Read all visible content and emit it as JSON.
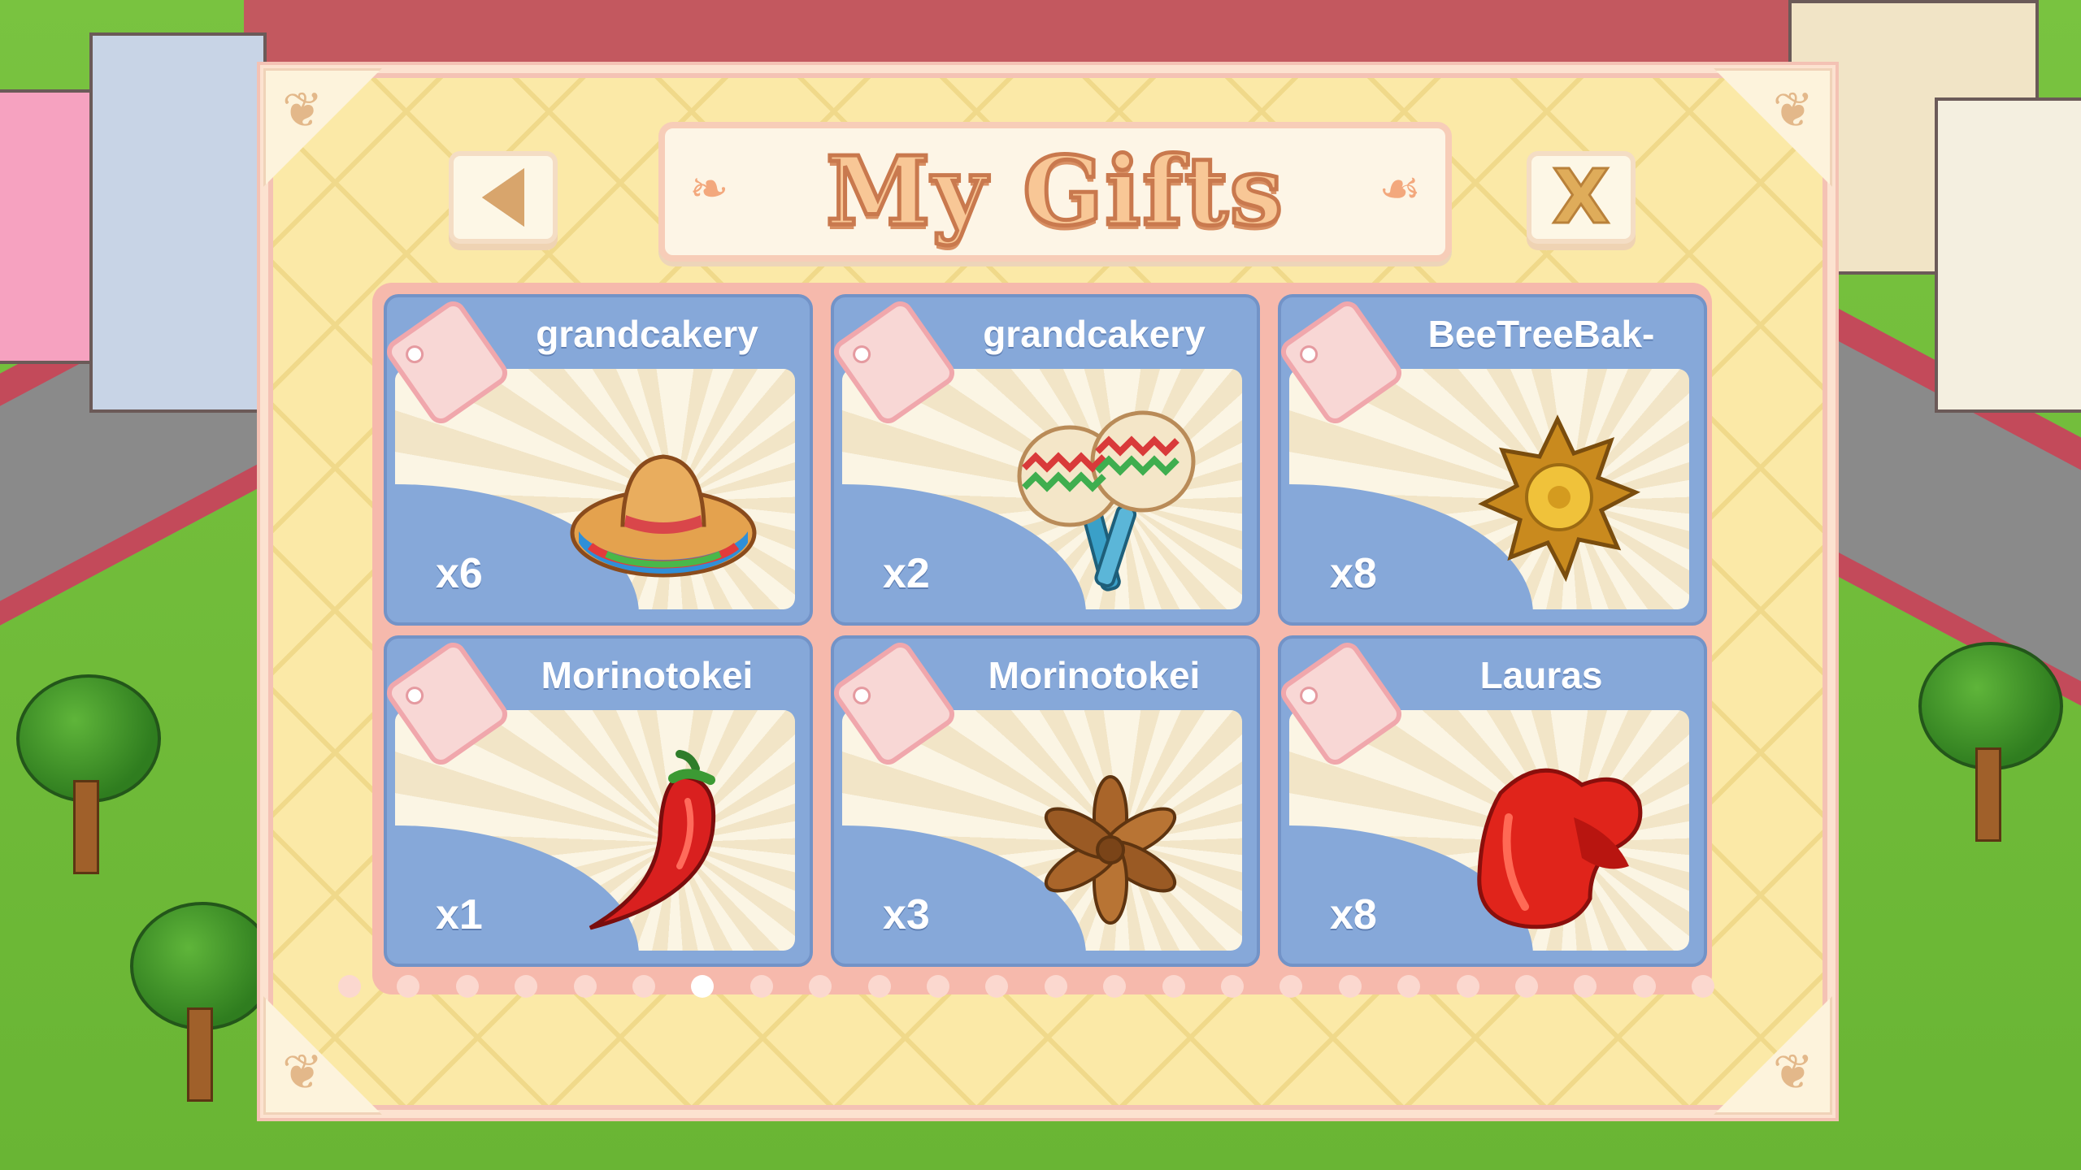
{
  "modal": {
    "title": "My Gifts",
    "back_button": "back-arrow-icon",
    "close_label": "X"
  },
  "gifts": [
    {
      "sender": "grandcakery",
      "quantity": "x6",
      "item": "sombrero-icon"
    },
    {
      "sender": "grandcakery",
      "quantity": "x2",
      "item": "maracas-icon"
    },
    {
      "sender": "BeeTreeBak-",
      "quantity": "x8",
      "item": "golden-flower-icon"
    },
    {
      "sender": "Morinotokei",
      "quantity": "x1",
      "item": "chili-pepper-icon"
    },
    {
      "sender": "Morinotokei",
      "quantity": "x3",
      "item": "star-anise-icon"
    },
    {
      "sender": "Lauras",
      "quantity": "x8",
      "item": "red-pepper-icon"
    }
  ],
  "pagination": {
    "total_pages": 24,
    "current_page": 7
  },
  "colors": {
    "modal_bg": "#fbe9a7",
    "card_blue": "#86a8d9",
    "title_orange": "#f8c796"
  }
}
